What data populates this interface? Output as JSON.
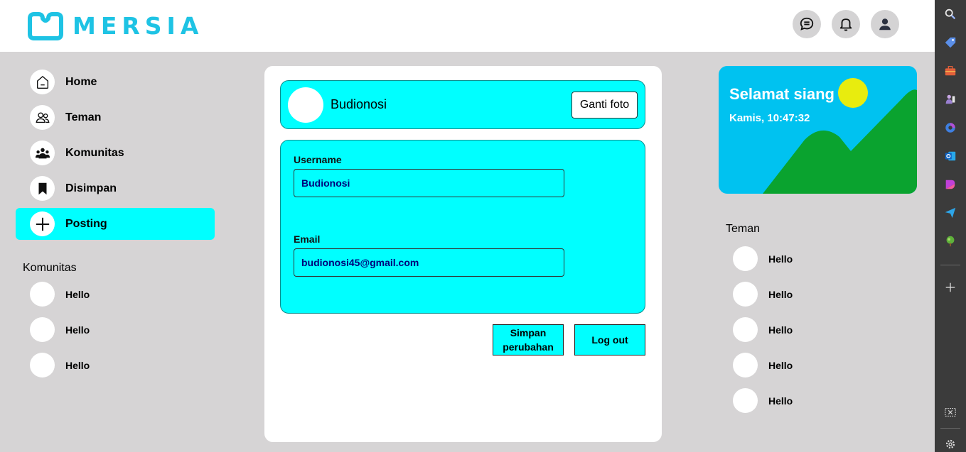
{
  "header": {
    "brand": "MERSIA",
    "icons": [
      "chat-icon",
      "bell-icon",
      "user-icon"
    ]
  },
  "sidebar": {
    "items": [
      {
        "label": "Home",
        "icon": "home-icon"
      },
      {
        "label": "Teman",
        "icon": "friends-icon"
      },
      {
        "label": "Komunitas",
        "icon": "community-icon"
      },
      {
        "label": "Disimpan",
        "icon": "bookmark-icon"
      },
      {
        "label": "Posting",
        "icon": "plus-icon",
        "active": true
      }
    ],
    "communities_title": "Komunitas",
    "communities": [
      "Hello",
      "Hello",
      "Hello"
    ]
  },
  "profile": {
    "name": "Budionosi",
    "change_photo_label": "Ganti foto",
    "username_label": "Username",
    "username_value": "Budionosi",
    "email_label": "Email",
    "email_value": "budionosi45@gmail.com",
    "save_label": "Simpan perubahan",
    "logout_label": "Log out"
  },
  "greeting": {
    "title": "Selamat siang",
    "datetime": "Kamis, 10:47:32"
  },
  "friends": {
    "title": "Teman",
    "items": [
      "Hello",
      "Hello",
      "Hello",
      "Hello",
      "Hello"
    ]
  },
  "colors": {
    "accent": "#00ffff",
    "brand": "#1ec3e4",
    "sky": "#00c2f0",
    "hill": "#0aa32f",
    "sun": "#e8ec0e",
    "background": "#d6d4d5"
  },
  "edgebar": {
    "icons": [
      "search-icon",
      "tag-icon",
      "briefcase-icon",
      "games-icon",
      "copilot-icon",
      "outlook-icon",
      "designer-icon",
      "send-icon",
      "tree-icon",
      "add-icon",
      "screenshot-icon",
      "settings-icon"
    ]
  }
}
